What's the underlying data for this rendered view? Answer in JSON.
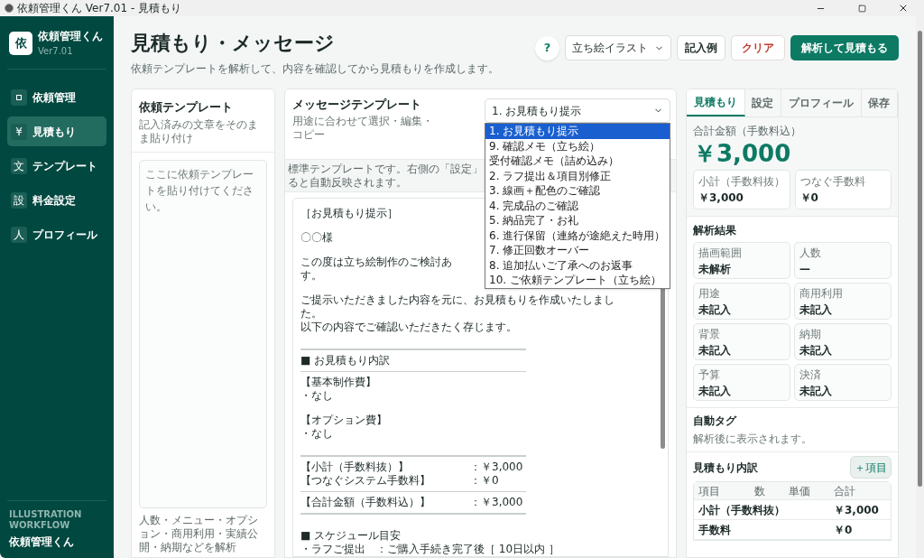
{
  "window": {
    "title": "依頼管理くん Ver7.01 - 見積もり"
  },
  "sidebar": {
    "app_name": "依頼管理くん",
    "version": "Ver7.01",
    "logo": "依",
    "items": [
      {
        "label": "依頼管理",
        "selected": false
      },
      {
        "glyph": "¥",
        "label": "見積もり",
        "selected": true
      },
      {
        "glyph": "文",
        "label": "テンプレート",
        "selected": false
      },
      {
        "glyph": "設",
        "label": "料金設定",
        "selected": false
      },
      {
        "glyph": "人",
        "label": "プロフィール",
        "selected": false
      }
    ],
    "footer_caption": "ILLUSTRATION WORKFLOW",
    "footer_name": "依頼管理くん"
  },
  "header": {
    "title": "見積もり・メッセージ",
    "subtitle": "依頼テンプレートを解析して、内容を確認してから見積もりを作成します。",
    "help": "?",
    "genre_select": "立ち絵イラスト",
    "example_button": "記入例",
    "clear_button": "クリア",
    "analyze_button": "解析して見積もる"
  },
  "request_panel": {
    "title": "依頼テンプレート",
    "subtitle": "記入済みの文章をそのまま貼り付け",
    "placeholder": "ここに依頼テンプレートを貼り付けてください。",
    "note": "人数・メニュー・オプション・商用利用・実績公開・納期などを解析"
  },
  "message_panel": {
    "title": "メッセージテンプレート",
    "subtitle": "用途に合わせて選択・編集・コピー",
    "select_value": "1. お見積もり提示",
    "options": [
      {
        "label": "1. お見積もり提示",
        "selected": true
      },
      {
        "label": "9. 確認メモ（立ち絵）",
        "selected": false
      },
      {
        "label": "受付確認メモ（詰め込み）",
        "selected": false
      },
      {
        "label": "2. ラフ提出＆項目別修正",
        "selected": false
      },
      {
        "label": "3. 線画＋配色のご確認",
        "selected": false
      },
      {
        "label": "4. 完成品のご確認",
        "selected": false
      },
      {
        "label": "5. 納品完了・お礼",
        "selected": false
      },
      {
        "label": "6. 進行保留（連絡が途絶えた時用）",
        "selected": false
      },
      {
        "label": "7. 修正回数オーバー",
        "selected": false
      },
      {
        "label": "8. 追加払いご了承へのお返事",
        "selected": false
      },
      {
        "label": "10. ご依頼テンプレート（立ち絵）",
        "selected": false
      }
    ],
    "note_lines": [
      "標準テンプレートです。右側の「設定」",
      "ると自動反映されます。"
    ],
    "body": [
      {
        "kind": "text",
        "text": "［お見積もり提示］"
      },
      {
        "kind": "gap"
      },
      {
        "kind": "text",
        "text": "〇〇様"
      },
      {
        "kind": "gap"
      },
      {
        "kind": "text",
        "text": "この度は立ち絵制作のご検討あ"
      },
      {
        "kind": "text",
        "text": "す。"
      },
      {
        "kind": "gap"
      },
      {
        "kind": "text",
        "text": "ご提示いただきました内容を元に、お見積もりを作成いたしまし"
      },
      {
        "kind": "text",
        "text": "た。"
      },
      {
        "kind": "text",
        "text": "以下の内容でご確認いただきたく存じます。"
      },
      {
        "kind": "gap"
      },
      {
        "kind": "rule"
      },
      {
        "kind": "text",
        "text": "■ お見積もり内訳"
      },
      {
        "kind": "rule"
      },
      {
        "kind": "text",
        "text": "【基本制作費】"
      },
      {
        "kind": "text",
        "text": "・なし"
      },
      {
        "kind": "gap"
      },
      {
        "kind": "text",
        "text": "【オプション費】"
      },
      {
        "kind": "text",
        "text": "・なし"
      },
      {
        "kind": "gap"
      },
      {
        "kind": "rule"
      },
      {
        "kind": "pair",
        "text": "【小計（手数料抜）】",
        "value": "：￥3,000"
      },
      {
        "kind": "pair",
        "text": "【つなぐシステム手数料】",
        "value": "：￥0"
      },
      {
        "kind": "rule"
      },
      {
        "kind": "pair",
        "text": "【合計金額（手数料込）】",
        "value": "：￥3,000"
      },
      {
        "kind": "rule"
      },
      {
        "kind": "gap"
      },
      {
        "kind": "text",
        "text": "■ スケジュール目安"
      },
      {
        "kind": "text",
        "text": "・ラフご提出　：ご購入手続き完了後［ 10日以内 ］"
      }
    ]
  },
  "result_panel": {
    "tabs": [
      {
        "label": "見積もり",
        "selected": true
      },
      {
        "label": "設定",
        "selected": false
      },
      {
        "label": "プロフィール",
        "selected": false
      },
      {
        "label": "保存",
        "selected": false
      }
    ],
    "total_label": "合計金額（手数料込）",
    "total": "￥3,000",
    "sub": [
      {
        "label": "小計（手数料抜）",
        "value": "￥3,000"
      },
      {
        "label": "つなぐ手数料",
        "value": "￥0"
      }
    ],
    "analysis_title": "解析結果",
    "analysis": [
      {
        "label": "描画範囲",
        "value": "未解析"
      },
      {
        "label": "人数",
        "value": "—"
      },
      {
        "label": "用途",
        "value": "未記入"
      },
      {
        "label": "商用利用",
        "value": "未記入"
      },
      {
        "label": "背景",
        "value": "未記入"
      },
      {
        "label": "納期",
        "value": "未記入"
      },
      {
        "label": "予算",
        "value": "未記入"
      },
      {
        "label": "決済",
        "value": "未記入"
      }
    ],
    "tags_title": "自動タグ",
    "tags_empty": "解析後に表示されます。",
    "breakdown_title": "見積もり内訳",
    "add_button": "＋項目",
    "columns": [
      "項目",
      "数",
      "単価",
      "合計"
    ],
    "rows": [
      {
        "item": "小計（手数料抜）",
        "total": "￥3,000"
      },
      {
        "item": "手数料",
        "total": "￥0"
      }
    ]
  }
}
